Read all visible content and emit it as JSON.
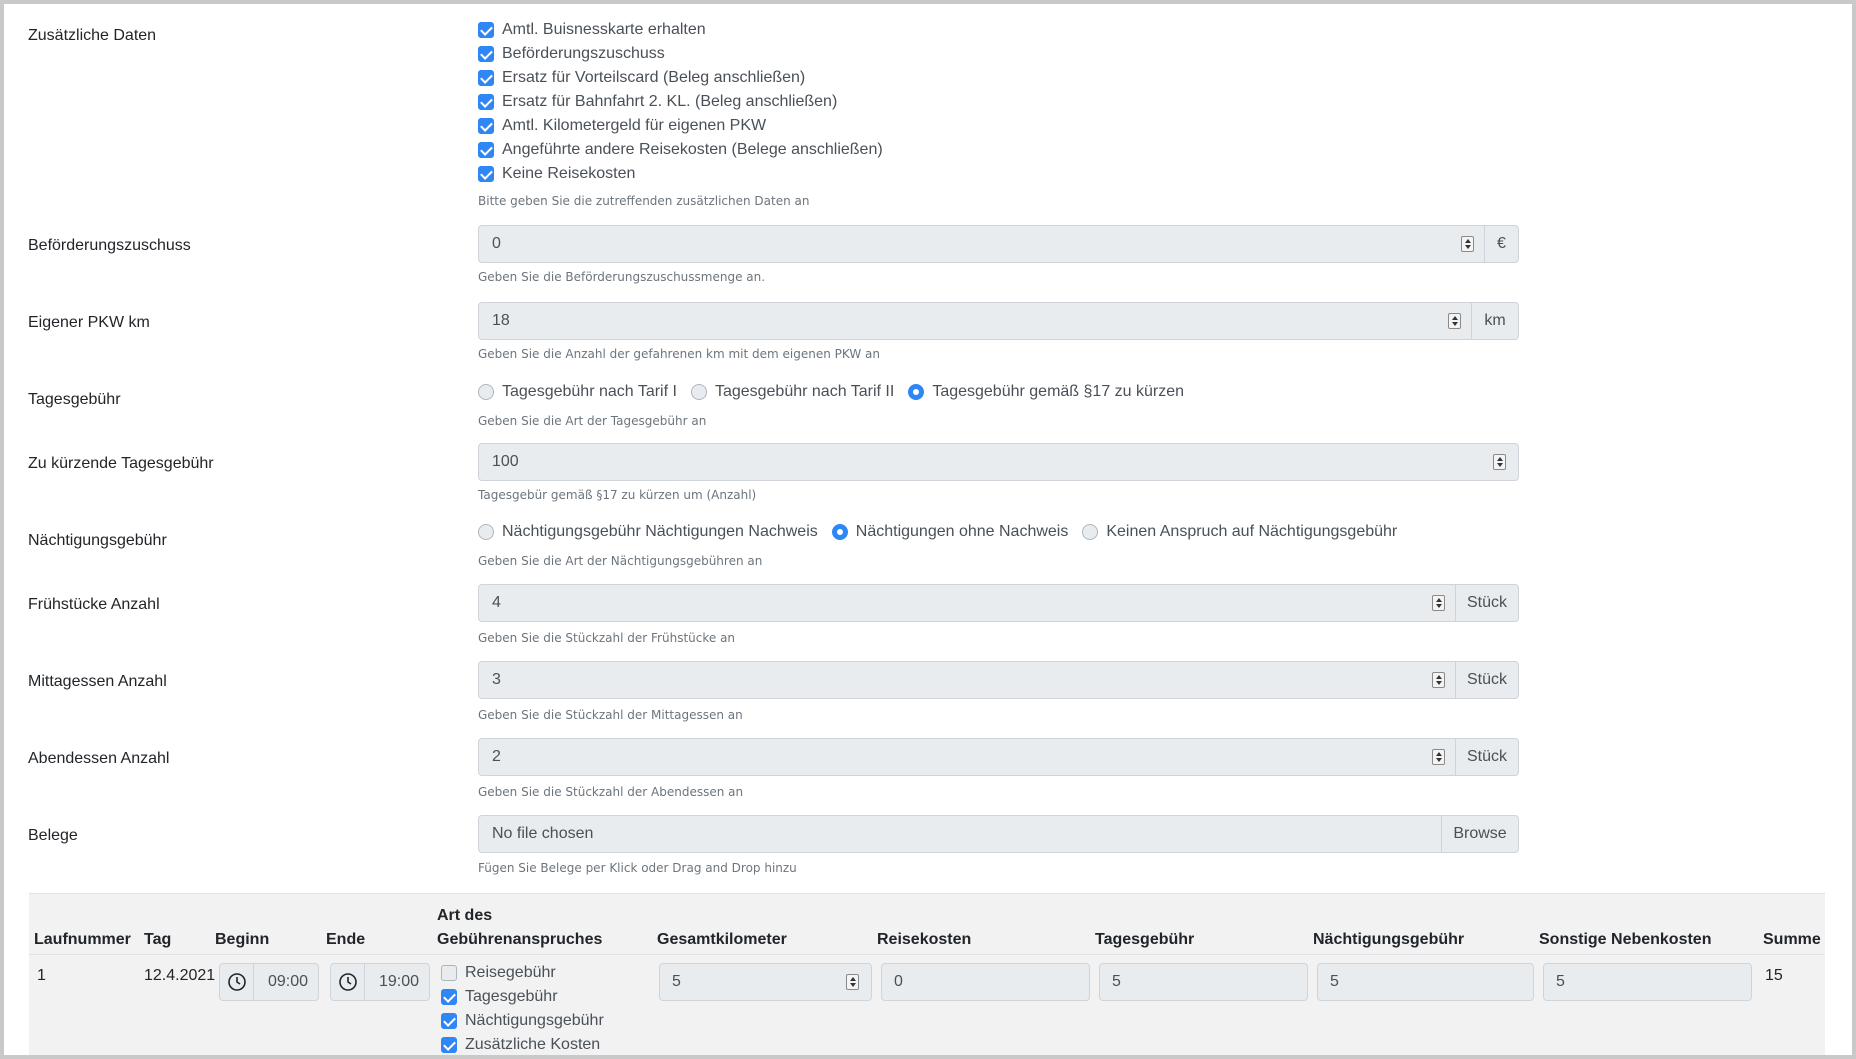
{
  "zusatz": {
    "label": "Zusätzliche Daten",
    "options": [
      {
        "label": "Amtl. Buisnesskarte erhalten",
        "checked": true
      },
      {
        "label": "Beförderungszuschuss",
        "checked": true
      },
      {
        "label": "Ersatz für Vorteilscard (Beleg anschließen)",
        "checked": true
      },
      {
        "label": "Ersatz für Bahnfahrt 2. KL. (Beleg anschließen)",
        "checked": true
      },
      {
        "label": "Amtl. Kilometergeld für eigenen PKW",
        "checked": true
      },
      {
        "label": "Angeführte andere Reisekosten (Belege anschließen)",
        "checked": true
      },
      {
        "label": "Keine Reisekosten",
        "checked": true
      }
    ],
    "help": "Bitte geben Sie die zutreffenden zusätzlichen Daten an"
  },
  "befoerderung": {
    "label": "Beförderungszuschuss",
    "value": "0",
    "unit": "€",
    "help": "Geben Sie die Beförderungszuschussmenge an."
  },
  "pkw": {
    "label": "Eigener PKW km",
    "value": "18",
    "unit": "km",
    "help": "Geben Sie die Anzahl der gefahrenen km mit dem eigenen PKW an"
  },
  "tagesgebuehr": {
    "label": "Tagesgebühr",
    "options": [
      "Tagesgebühr nach Tarif I",
      "Tagesgebühr nach Tarif II",
      "Tagesgebühr gemäß §17 zu kürzen"
    ],
    "selected": 2,
    "help": "Geben Sie die Art der Tagesgebühr an"
  },
  "kuerzen": {
    "label": "Zu kürzende Tagesgebühr",
    "value": "100",
    "help": "Tagesgebür gemäß §17 zu kürzen um (Anzahl)"
  },
  "naechtigung": {
    "label": "Nächtigungsgebühr",
    "options": [
      "Nächtigungsgebühr Nächtigungen Nachweis",
      "Nächtigungen ohne Nachweis",
      "Keinen Anspruch auf Nächtigungsgebühr"
    ],
    "selected": 1,
    "help": "Geben Sie die Art der Nächtigungsgebühren an"
  },
  "fruehstueck": {
    "label": "Frühstücke Anzahl",
    "value": "4",
    "unit": "Stück",
    "help": "Geben Sie die Stückzahl der Frühstücke an"
  },
  "mittag": {
    "label": "Mittagessen Anzahl",
    "value": "3",
    "unit": "Stück",
    "help": "Geben Sie die Stückzahl der Mittagessen an"
  },
  "abend": {
    "label": "Abendessen Anzahl",
    "value": "2",
    "unit": "Stück",
    "help": "Geben Sie die Stückzahl der Abendessen an"
  },
  "belege": {
    "label": "Belege",
    "value": "No file chosen",
    "button": "Browse",
    "help": "Fügen Sie Belege per Klick oder Drag and Drop hinzu"
  },
  "table": {
    "headers": {
      "laufnummer": "Laufnummer",
      "tag": "Tag",
      "beginn": "Beginn",
      "ende": "Ende",
      "art_line1": "Art des",
      "art_line2": "Gebührenanspruches",
      "gesamtkm": "Gesamtkilometer",
      "reisekosten": "Reisekosten",
      "tagesgebuehr": "Tagesgebühr",
      "naechtigung": "Nächtigungsgebühr",
      "sonstige": "Sonstige Nebenkosten",
      "summe": "Summe"
    },
    "row": {
      "laufnummer": "1",
      "tag": "12.4.2021",
      "beginn": "09:00",
      "ende": "19:00",
      "art": [
        {
          "label": "Reisegebühr",
          "checked": false
        },
        {
          "label": "Tagesgebühr",
          "checked": true
        },
        {
          "label": "Nächtigungsgebühr",
          "checked": true
        },
        {
          "label": "Zusätzliche Kosten",
          "checked": true
        }
      ],
      "gesamtkm": "5",
      "reisekosten": "0",
      "tagesgebuehr": "5",
      "naechtigung": "5",
      "sonstige": "5",
      "summe": "15"
    }
  },
  "colors": {
    "accent": "#2f86f5",
    "input_bg": "#e9ecef",
    "help_text": "#6c757d"
  }
}
